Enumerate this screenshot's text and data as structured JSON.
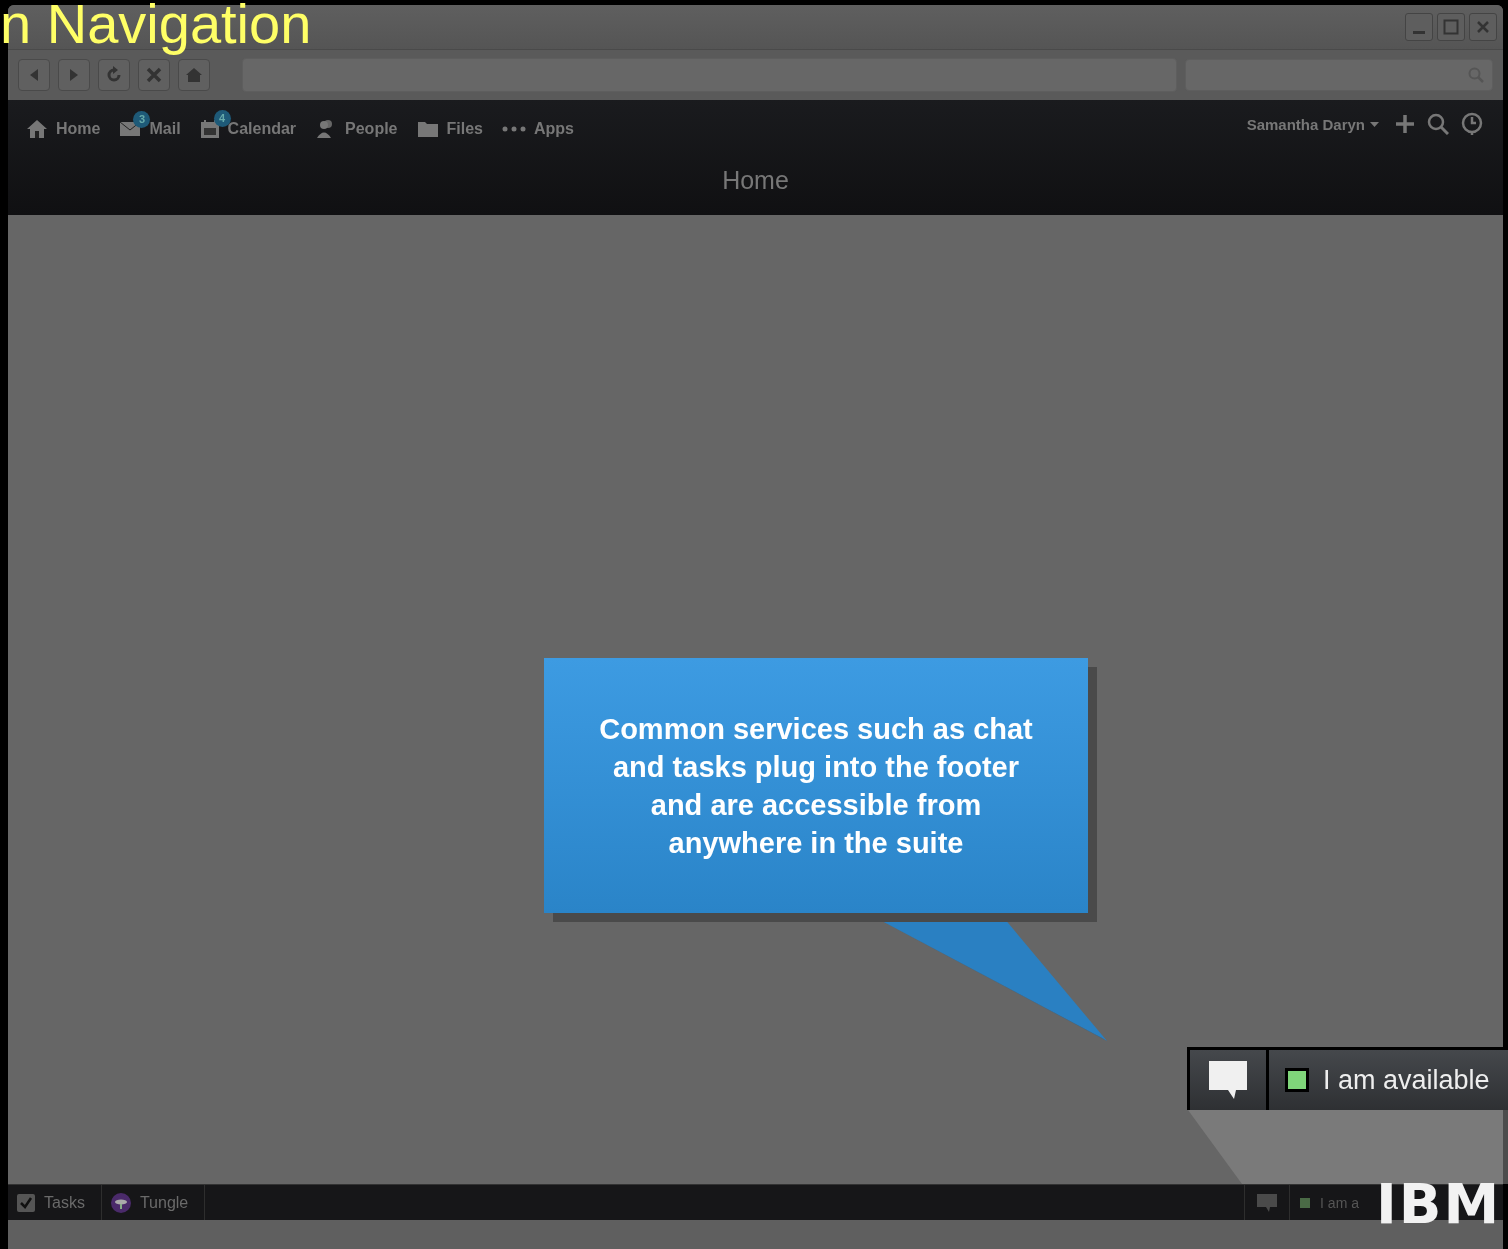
{
  "slide_title": "n Navigation",
  "app_nav": {
    "items": [
      {
        "kind": "home",
        "label": "Home"
      },
      {
        "kind": "mail",
        "label": "Mail",
        "badge": "3"
      },
      {
        "kind": "calendar",
        "label": "Calendar",
        "badge": "4"
      },
      {
        "kind": "people",
        "label": "People"
      },
      {
        "kind": "files",
        "label": "Files"
      },
      {
        "kind": "apps",
        "label": "Apps"
      }
    ],
    "user": "Samantha Daryn"
  },
  "page_title": "Home",
  "callout": "Common services such as chat and tasks plug into the footer and are accessible from anywhere in the suite",
  "footer": {
    "items": [
      {
        "kind": "tasks",
        "label": "Tasks"
      },
      {
        "kind": "tungle",
        "label": "Tungle"
      }
    ],
    "status": "I am a"
  },
  "zoom_status": "I am available",
  "logo": "IBM"
}
